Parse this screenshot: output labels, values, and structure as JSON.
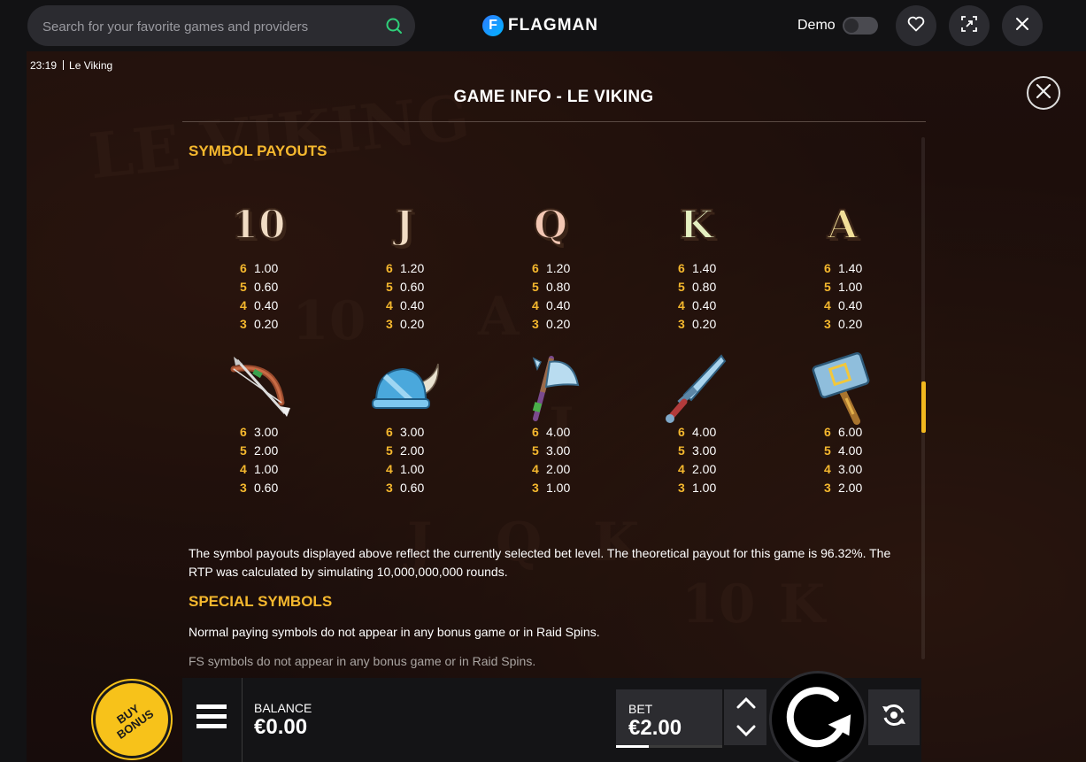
{
  "header": {
    "search_placeholder": "Search for your favorite games and providers",
    "brand_letter": "F",
    "brand_name": "FLAGMAN",
    "demo_label": "Demo",
    "demo_enabled": false
  },
  "game": {
    "clock": "23:19",
    "game_name": "Le Viking",
    "title": "GAME INFO - LE VIKING",
    "symbol_payouts_heading": "SYMBOL PAYOUTS",
    "symbols_row1": [
      {
        "name": "10",
        "icon": "card-10-icon",
        "pays": [
          {
            "n": "6",
            "v": "1.00"
          },
          {
            "n": "5",
            "v": "0.60"
          },
          {
            "n": "4",
            "v": "0.40"
          },
          {
            "n": "3",
            "v": "0.20"
          }
        ]
      },
      {
        "name": "J",
        "icon": "card-j-icon",
        "pays": [
          {
            "n": "6",
            "v": "1.20"
          },
          {
            "n": "5",
            "v": "0.60"
          },
          {
            "n": "4",
            "v": "0.40"
          },
          {
            "n": "3",
            "v": "0.20"
          }
        ]
      },
      {
        "name": "Q",
        "icon": "card-q-icon",
        "pays": [
          {
            "n": "6",
            "v": "1.20"
          },
          {
            "n": "5",
            "v": "0.80"
          },
          {
            "n": "4",
            "v": "0.40"
          },
          {
            "n": "3",
            "v": "0.20"
          }
        ]
      },
      {
        "name": "K",
        "icon": "card-k-icon",
        "pays": [
          {
            "n": "6",
            "v": "1.40"
          },
          {
            "n": "5",
            "v": "0.80"
          },
          {
            "n": "4",
            "v": "0.40"
          },
          {
            "n": "3",
            "v": "0.20"
          }
        ]
      },
      {
        "name": "A",
        "icon": "card-a-icon",
        "pays": [
          {
            "n": "6",
            "v": "1.40"
          },
          {
            "n": "5",
            "v": "1.00"
          },
          {
            "n": "4",
            "v": "0.40"
          },
          {
            "n": "3",
            "v": "0.20"
          }
        ]
      }
    ],
    "symbols_row2": [
      {
        "icon": "bow-icon",
        "pays": [
          {
            "n": "6",
            "v": "3.00"
          },
          {
            "n": "5",
            "v": "2.00"
          },
          {
            "n": "4",
            "v": "1.00"
          },
          {
            "n": "3",
            "v": "0.60"
          }
        ]
      },
      {
        "icon": "helmet-icon",
        "pays": [
          {
            "n": "6",
            "v": "3.00"
          },
          {
            "n": "5",
            "v": "2.00"
          },
          {
            "n": "4",
            "v": "1.00"
          },
          {
            "n": "3",
            "v": "0.60"
          }
        ]
      },
      {
        "icon": "axe-icon",
        "pays": [
          {
            "n": "6",
            "v": "4.00"
          },
          {
            "n": "5",
            "v": "3.00"
          },
          {
            "n": "4",
            "v": "2.00"
          },
          {
            "n": "3",
            "v": "1.00"
          }
        ]
      },
      {
        "icon": "sword-icon",
        "pays": [
          {
            "n": "6",
            "v": "4.00"
          },
          {
            "n": "5",
            "v": "3.00"
          },
          {
            "n": "4",
            "v": "2.00"
          },
          {
            "n": "3",
            "v": "1.00"
          }
        ]
      },
      {
        "icon": "hammer-icon",
        "pays": [
          {
            "n": "6",
            "v": "6.00"
          },
          {
            "n": "5",
            "v": "4.00"
          },
          {
            "n": "4",
            "v": "3.00"
          },
          {
            "n": "3",
            "v": "2.00"
          }
        ]
      }
    ],
    "payout_note": "The symbol payouts displayed above reflect the currently selected bet level. The theoretical payout for this game is 96.32%. The RTP was calculated by simulating 10,000,000,000 rounds.",
    "special_symbols_heading": "SPECIAL SYMBOLS",
    "special_line1": "Normal paying symbols do not appear in any bonus game or in Raid Spins.",
    "special_line2": "FS symbols do not appear in any bonus game or in Raid Spins."
  },
  "controls": {
    "buy_bonus_label": "BUY BONUS",
    "balance_label": "BALANCE",
    "balance_value": "€0.00",
    "bet_label": "BET",
    "bet_value": "€2.00"
  },
  "colors": {
    "accent": "#f5b82e",
    "buy_bonus": "#f7c21a",
    "background": "#121214"
  }
}
